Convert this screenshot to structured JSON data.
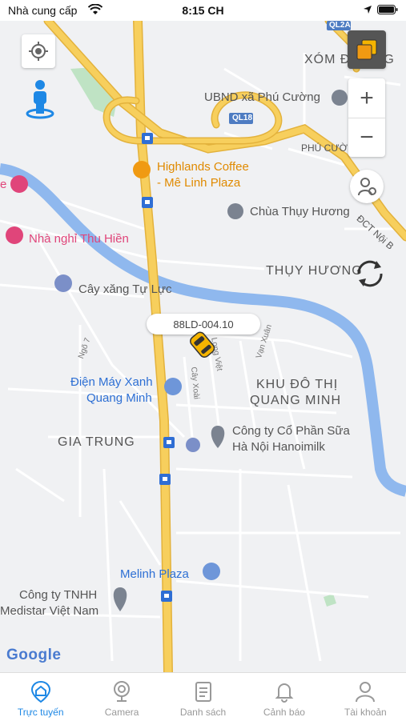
{
  "status_bar": {
    "carrier": "Nhà cung cấp",
    "time": "8:15 CH"
  },
  "map": {
    "labels": {
      "xom_duong": "XÓM ĐƯỜNG",
      "ubnd": "UBND xã Phú Cường",
      "ql18": "QL18",
      "ql2a": "QL2A",
      "phu_cuong": "PHÚ CƯỜ",
      "highlands_1": "Highlands Coffee",
      "highlands_2": "- Mê Linh Plaza",
      "nha_nghi_1": "e",
      "chua": "Chùa Thụy Hương",
      "dct": "ĐCT Nội B",
      "nha_nghi": "Nhà nghỉ Thu Hiền",
      "thuy_huong": "THỤY HƯƠNG",
      "cay_xang": "Cây xăng Tự Lực",
      "ngo7": "Ngõ 7",
      "long_viet": "Long Việt",
      "van_xuan": "Vạn Xuân",
      "cay_xoai": "Cây Xoài",
      "dien_may_1": "Điện Máy Xanh",
      "dien_may_2": "Quang Minh",
      "khu_do_thi_1": "KHU ĐÔ THỊ",
      "khu_do_thi_2": "QUANG MINH",
      "gia_trung": "GIA TRUNG",
      "hanoimilk_1": "Công ty Cổ Phần Sữa",
      "hanoimilk_2": "Hà Nội Hanoimilk",
      "melinh": "Melinh Plaza",
      "tnhh_1": "Công ty TNHH",
      "tnhh_2": "Medistar Việt Nam",
      "google": "Google"
    },
    "vehicle_plate": "88LD-004.10",
    "zoom_in": "+",
    "zoom_out": "−"
  },
  "tabs": [
    {
      "label": "Trực tuyến",
      "icon": "map-pin-home-icon",
      "active": true
    },
    {
      "label": "Camera",
      "icon": "camera-icon",
      "active": false
    },
    {
      "label": "Danh sách",
      "icon": "list-icon",
      "active": false
    },
    {
      "label": "Cảnh báo",
      "icon": "bell-icon",
      "active": false
    },
    {
      "label": "Tài khoản",
      "icon": "person-icon",
      "active": false
    }
  ],
  "colors": {
    "accent": "#1e88e5",
    "road_major": "#f5c445",
    "river": "#8fb8ee",
    "park": "#bfe3c4"
  }
}
